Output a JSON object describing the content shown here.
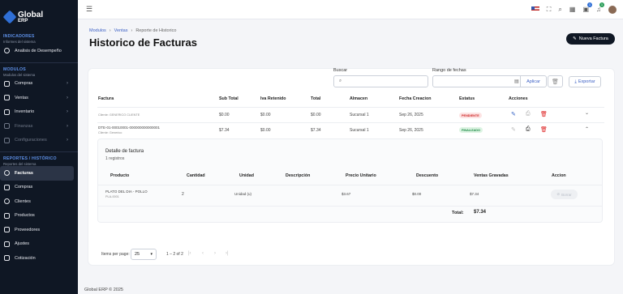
{
  "brand": {
    "line1": "Global",
    "line2": "ERP"
  },
  "sidebar": {
    "sections": [
      {
        "title": "INDICADORES",
        "subtitle": "Informes del sistema",
        "items": [
          {
            "label": "Analisis de Desempeño"
          }
        ]
      },
      {
        "title": "MODULOS",
        "subtitle": "Modulos del sistema",
        "items": [
          {
            "label": "Compras"
          },
          {
            "label": "Ventas"
          },
          {
            "label": "Inventario"
          },
          {
            "label": "Finanzas"
          },
          {
            "label": "Configuraciones"
          }
        ]
      },
      {
        "title": "REPORTES / HISTÓRICO",
        "subtitle": "Reportes del sistema",
        "items": [
          {
            "label": "Facturas"
          },
          {
            "label": "Compras"
          },
          {
            "label": "Clientes"
          },
          {
            "label": "Productos"
          },
          {
            "label": "Proveedores"
          },
          {
            "label": "Ajustes"
          },
          {
            "label": "Cotización"
          }
        ]
      }
    ]
  },
  "topbar": {
    "badge1": "1",
    "badge2": "1"
  },
  "breadcrumb": {
    "a": "Modulos",
    "b": "Ventas",
    "c": "Reporte de Historico"
  },
  "page": {
    "title": "Historico de Facturas",
    "new_button": "Nueva Factura"
  },
  "filters": {
    "search_label": "Buscar",
    "range_label": "Rango de fechas",
    "apply": "Aplicar",
    "export": "Exportar"
  },
  "table": {
    "headers": [
      "Factura",
      "Sub Total",
      "Iva Retenido",
      "Total",
      "Almacen",
      "Fecha Creacion",
      "Estatus",
      "Acciones"
    ],
    "rows": [
      {
        "invoice": "",
        "client": "Cliente: GENERICO CLIENTE",
        "subtotal": "$0.00",
        "iva": "$0.00",
        "total": "$0.00",
        "almacen": "Sucursal 1",
        "fecha": "Sep 26, 2025",
        "estatus": "PENDIENTE"
      },
      {
        "invoice": "DTE-01-00010001-000000000000001",
        "client": "Cliente: Generico",
        "subtotal": "$7.34",
        "iva": "$0.00",
        "total": "$7.34",
        "almacen": "Sucursal 1",
        "fecha": "Sep 26, 2025",
        "estatus": "FINALIZADO"
      }
    ]
  },
  "detail": {
    "title": "Detalle de factura",
    "count": "1 registros",
    "headers": [
      "Producto",
      "Cantidad",
      "Unidad",
      "Descripción",
      "Precio Unitario",
      "Descuento",
      "Ventas Gravadas",
      "Accion"
    ],
    "row": {
      "product": "PLATO DEL DIA - POLLO",
      "code": "PLA-0001",
      "qty": "2",
      "unit": "Unidad (u)",
      "desc": "",
      "price": "$3.67",
      "disc": "$0.00",
      "gravadas": "$7.34",
      "action": "Borrar"
    },
    "total_label": "Total:",
    "total_value": "$7.34"
  },
  "pagination": {
    "items_per_page_label": "Items per page:",
    "page_size": "25",
    "range": "1 – 2 of 2"
  },
  "footer": "Global ERP © 2025"
}
